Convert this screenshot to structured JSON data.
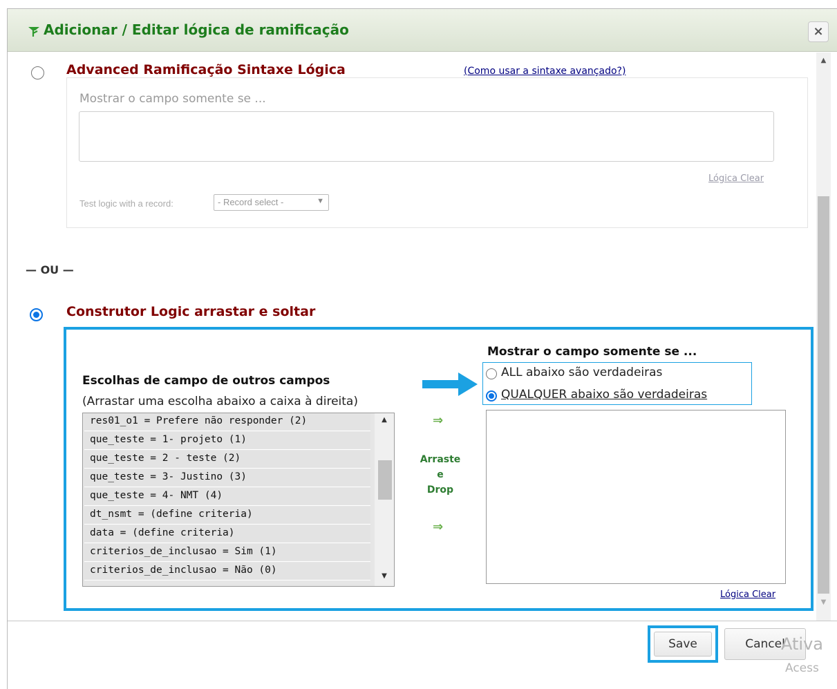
{
  "dialog": {
    "title": "Adicionar / Editar lógica de ramificação",
    "close_label": "×",
    "title_icon": "branching-logic-icon"
  },
  "advanced": {
    "title": "Advanced Ramificação Sintaxe Lógica",
    "help_link": "(Como usar a sintaxe avançado?)",
    "show_field_label": "Mostrar o campo somente se ...",
    "logic_value": "",
    "clear_link": "Lógica Clear",
    "test_label": "Test logic with a record:",
    "record_select_value": "- Record select -",
    "selected": false
  },
  "separator": "— OU —",
  "builder": {
    "title": "Construtor Logic arrastar e soltar",
    "selected": true,
    "choices_title": "Escolhas de campo de outros campos",
    "choices_subtitle": "(Arrastar uma escolha abaixo a caixa à direita)",
    "choices": [
      "res01_o1 = Prefere não responder (2)",
      "que_teste = 1- projeto (1)",
      "que_teste = 2 - teste (2)",
      "que_teste = 3- Justino (3)",
      "que_teste = 4- NMT (4)",
      "dt_nsmt = (define criteria)",
      "data = (define criteria)",
      "criterios_de_inclusao = Sim (1)",
      "criterios_de_inclusao = Não (0)"
    ],
    "drag_line1": "Arraste",
    "drag_line2": "e",
    "drag_line3": "Drop",
    "arrow_glyph": "⇒",
    "show_title": "Mostrar o campo somente se ...",
    "option_all": "ALL abaixo são verdadeiras",
    "option_any": "QUALQUER abaixo são verdadeiras",
    "option_any_selected": true,
    "clear_link": "Lógica Clear"
  },
  "footer": {
    "save_label": "Save",
    "cancel_label": "Cancel"
  },
  "watermark": {
    "line1": "Ativa",
    "line2": "Acess"
  },
  "colors": {
    "title_green": "#1d7d1d",
    "section_red": "#800000",
    "highlight_blue": "#1ba1e2",
    "radio_blue": "#0b74e5"
  }
}
